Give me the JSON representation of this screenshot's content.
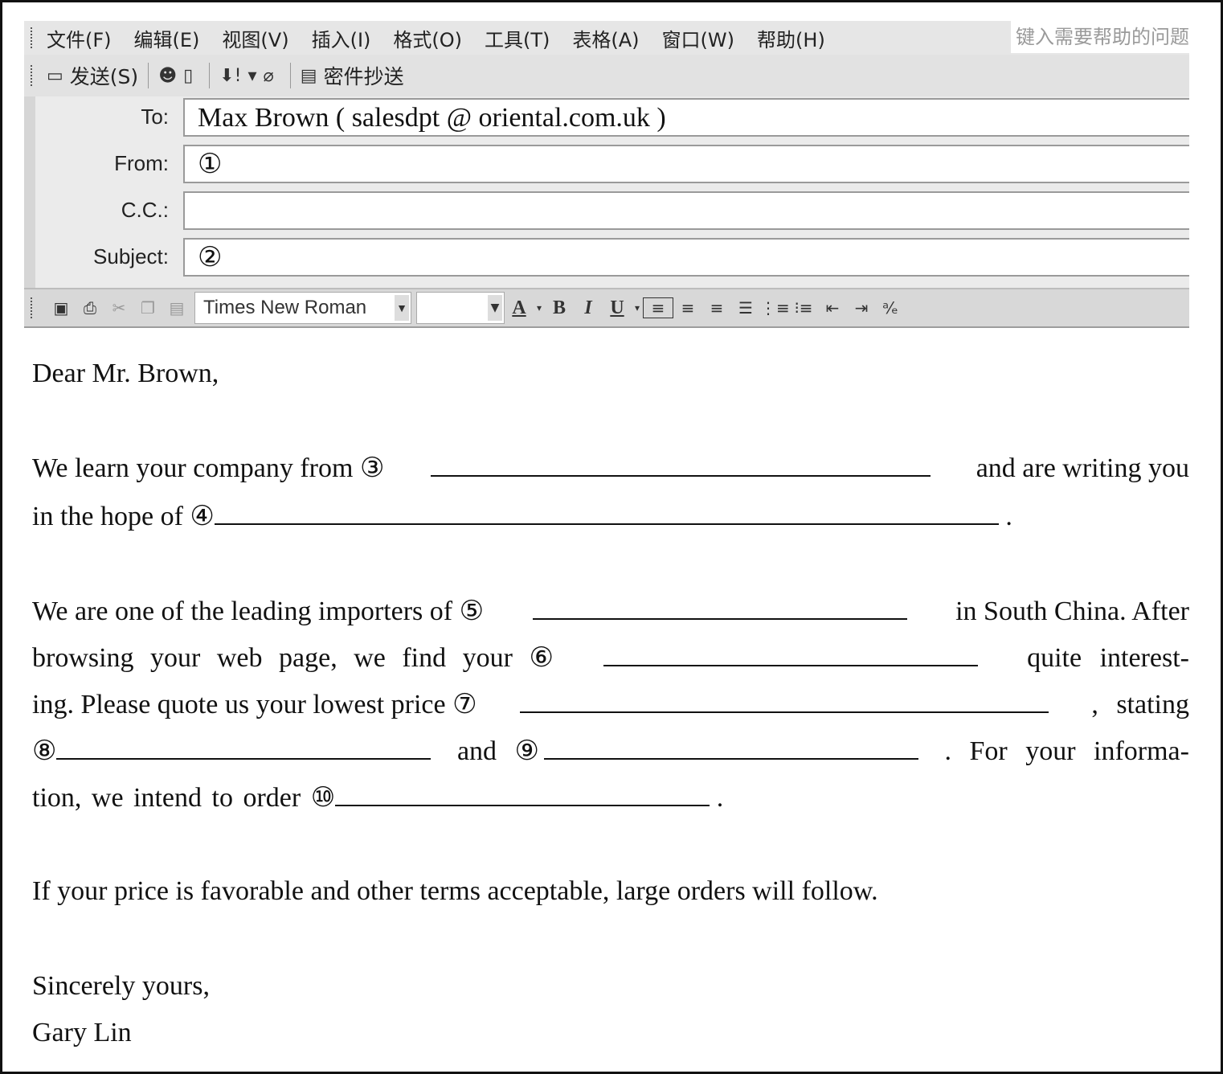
{
  "menu": {
    "items": [
      "文件(F)",
      "编辑(E)",
      "视图(V)",
      "插入(I)",
      "格式(O)",
      "工具(T)",
      "表格(A)",
      "窗口(W)",
      "帮助(H)"
    ],
    "help_placeholder": "键入需要帮助的问题"
  },
  "send_toolbar": {
    "send_label": "发送(S)",
    "bcc_label": "密件抄送"
  },
  "headers": {
    "to_label": "To:",
    "to_value": "Max Brown ( salesdpt @ oriental.com.uk )",
    "from_label": "From:",
    "from_value": "①",
    "cc_label": "C.C.:",
    "cc_value": "",
    "subject_label": "Subject:",
    "subject_value": "②"
  },
  "format_toolbar": {
    "font": "Times New Roman",
    "font_size": ""
  },
  "letter": {
    "greeting": "Dear Mr. Brown,",
    "p1_a": "We learn your company from ③",
    "p1_b": "and are writing you",
    "p1_c": "in the hope of ④",
    "p1_end": ".",
    "p2_l1a": "We are one of the leading importers of ⑤",
    "p2_l1b": "in South China. After",
    "p2_l2a": "browsing your web page, we find your ⑥",
    "p2_l2b": "quite interest-",
    "p2_l3a": "ing. Please quote us your lowest price ⑦",
    "p2_l3b": ", stating",
    "p2_l4a": "⑧",
    "p2_l4b": "and ⑨",
    "p2_l4c": ". For your informa-",
    "p2_l5a": "tion, we intend to order ⑩",
    "p2_l5b": ".",
    "p3": "If your price is favorable and other terms acceptable, large orders will follow.",
    "closing": "Sincerely yours,",
    "signature": "Gary Lin"
  }
}
